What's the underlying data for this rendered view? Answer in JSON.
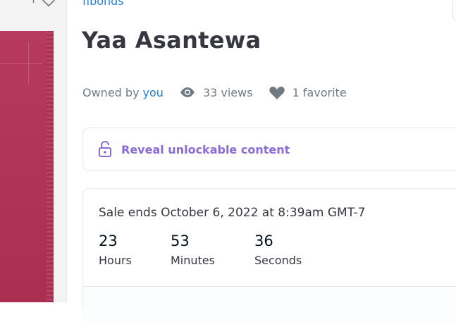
{
  "collection": {
    "name": "fibonds"
  },
  "asset": {
    "title": "Yaa Asantewa"
  },
  "meta": {
    "owned_prefix": "Owned by",
    "owner": "you",
    "views": "33 views",
    "favorites": "1 favorite"
  },
  "unlockable": {
    "label": "Reveal unlockable content"
  },
  "sale": {
    "ends_text": "Sale ends October 6, 2022 at 8:39am GMT-7",
    "timer": [
      {
        "value": "23",
        "unit": "Hours"
      },
      {
        "value": "53",
        "unit": "Minutes"
      },
      {
        "value": "36",
        "unit": "Seconds"
      }
    ]
  },
  "colors": {
    "link": "#2081e2",
    "unlock": "#8b6bd8",
    "artwork": "#b03557",
    "icon_gray": "#707a83"
  }
}
